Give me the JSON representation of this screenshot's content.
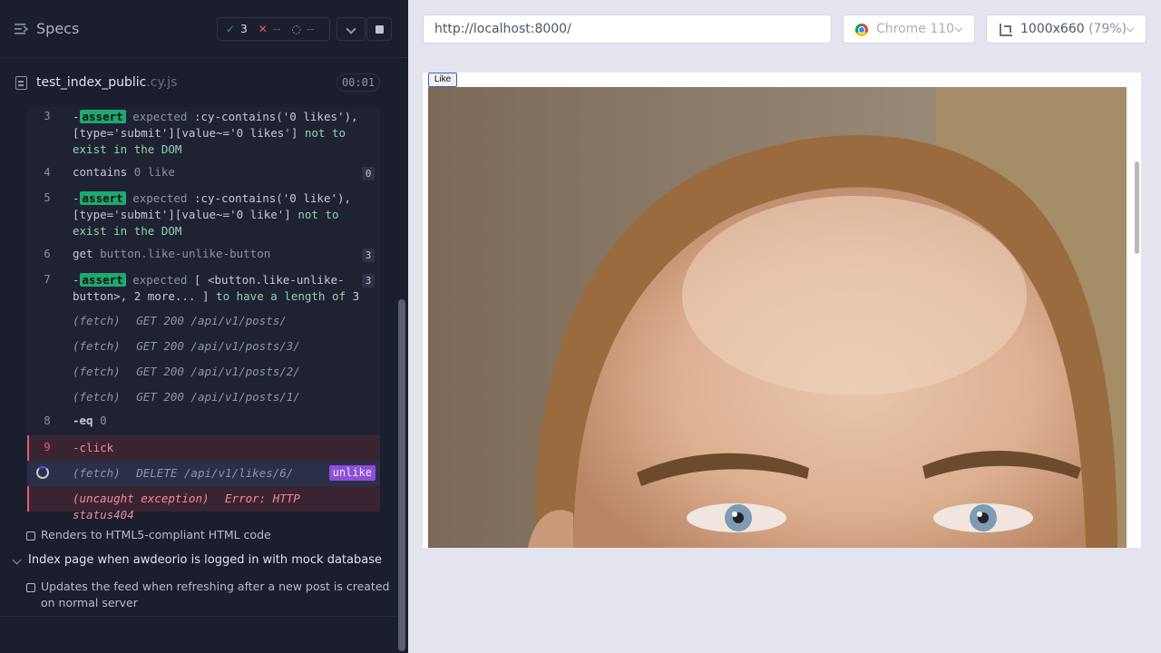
{
  "runner": {
    "header": {
      "title": "Specs"
    },
    "stats": {
      "passed": "3",
      "failed": "--",
      "pending": "--"
    },
    "spec_file": {
      "name": "test_index_public",
      "ext": ".cy.js",
      "duration": "00:01"
    },
    "commands": [
      {
        "num": "3",
        "cmd": "-",
        "tag": "assert",
        "l1a": "expected ",
        "l1b": ":cy-contains('0 likes'),",
        "l2a": "[type='submit'][value~='0 likes']",
        "l2b": " not to",
        "l3": "exist in the DOM"
      },
      {
        "num": "4",
        "cmd": "contains",
        "arg": "0 like",
        "count": "0"
      },
      {
        "num": "5",
        "cmd": "-",
        "tag": "assert",
        "l1a": "expected ",
        "l1b": ":cy-contains('0 like'),",
        "l2a": "[type='submit'][value~='0 like']",
        "l2b": " not to",
        "l3": "exist in the DOM"
      },
      {
        "num": "6",
        "cmd": "get",
        "arg": "button.like-unlike-button",
        "count": "3"
      },
      {
        "num": "7",
        "cmd": "-",
        "tag": "assert",
        "l1a": "expected ",
        "l1b": "[ <button.like-unlike-",
        "l2a": "button>, 2 more... ]",
        "l2b": " to have a length of ",
        "l2c": "3",
        "count": "3"
      },
      {
        "label": "(fetch)",
        "detail": "GET 200 /api/v1/posts/"
      },
      {
        "label": "(fetch)",
        "detail": "GET 200 /api/v1/posts/3/"
      },
      {
        "label": "(fetch)",
        "detail": "GET 200 /api/v1/posts/2/"
      },
      {
        "label": "(fetch)",
        "detail": "GET 200 /api/v1/posts/1/"
      },
      {
        "num": "8",
        "cmd": "-eq",
        "arg": "0"
      },
      {
        "num": "9",
        "cmd": "-click"
      },
      {
        "label": "(fetch)",
        "detail": "DELETE /api/v1/likes/6/",
        "alias": "unlike"
      },
      {
        "label": "(uncaught exception)",
        "detail": "Error: HTTP status404"
      }
    ],
    "tests": [
      {
        "title": "Renders to HTML5-compliant HTML code"
      },
      {
        "title": "Index page when awdeorio is logged in with mock database"
      },
      {
        "title_line1": "Updates the feed when refreshing after a new post is created",
        "title_line2": "on normal server"
      }
    ]
  },
  "preview": {
    "url": "http://localhost:8000/",
    "browser": "Chrome 110",
    "viewport": {
      "size": "1000x660",
      "scale": "(79%)"
    },
    "app": {
      "like_button": "Like"
    }
  }
}
